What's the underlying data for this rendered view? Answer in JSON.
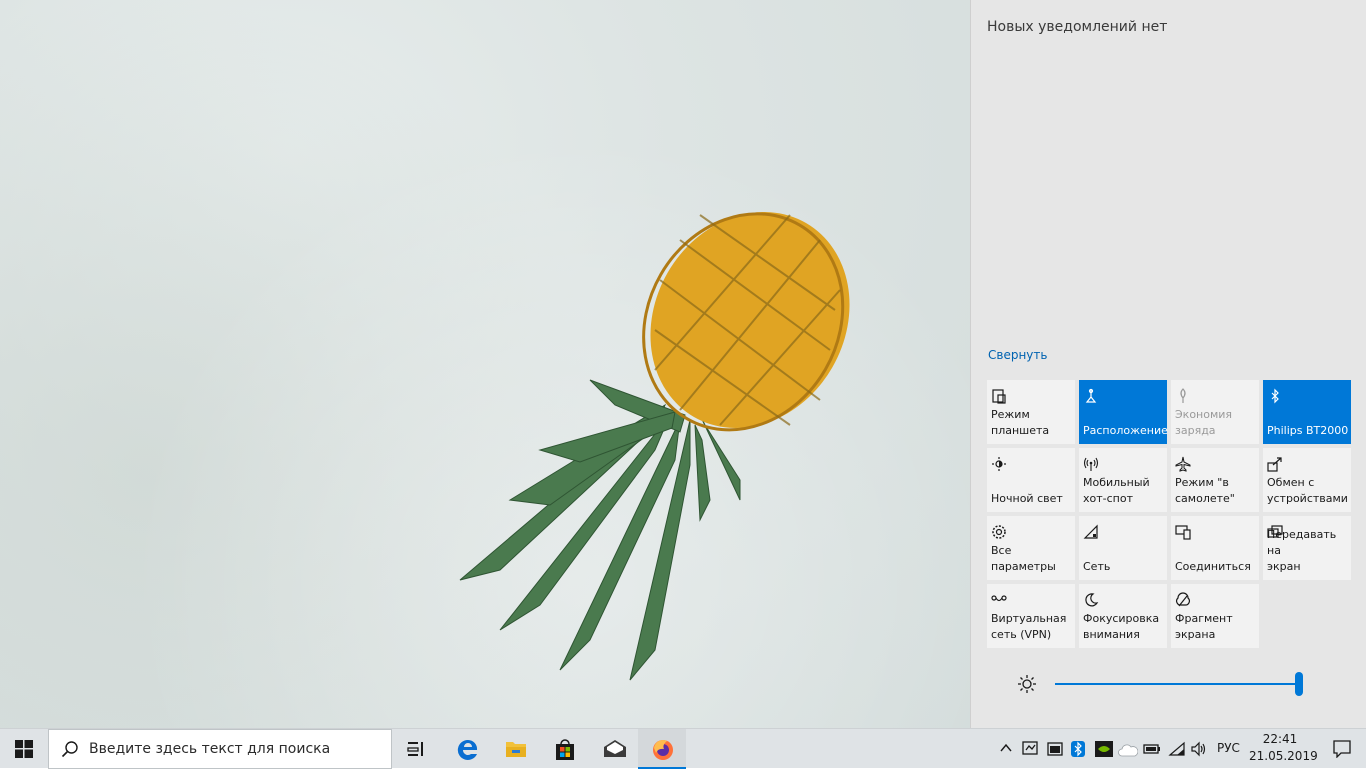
{
  "action_center": {
    "no_notifications": "Новых уведомлений нет",
    "collapse": "Свернуть",
    "tiles": [
      {
        "label": "Режим\nпланшета",
        "icon": "tablet-mode-icon",
        "state": "off"
      },
      {
        "label": "Расположение",
        "icon": "location-icon",
        "state": "on"
      },
      {
        "label": "Экономия\nзаряда",
        "icon": "battery-saver-icon",
        "state": "disabled"
      },
      {
        "label": "Philips BT2000",
        "icon": "bluetooth-icon",
        "state": "on"
      },
      {
        "label": "Ночной свет",
        "icon": "night-light-icon",
        "state": "off"
      },
      {
        "label": "Мобильный\nхот-спот",
        "icon": "mobile-hotspot-icon",
        "state": "off"
      },
      {
        "label": "Режим \"в\nсамолете\"",
        "icon": "airplane-icon",
        "state": "off"
      },
      {
        "label": "Обмен с\nустройствами",
        "icon": "nearby-sharing-icon",
        "state": "off"
      },
      {
        "label": "Все\nпараметры",
        "icon": "settings-gear-icon",
        "state": "off"
      },
      {
        "label": "Сеть",
        "icon": "network-icon",
        "state": "off"
      },
      {
        "label": "Соединиться",
        "icon": "connect-icon",
        "state": "off"
      },
      {
        "label": "Передавать на\nэкран",
        "icon": "project-icon",
        "state": "off"
      },
      {
        "label": "Виртуальная\nсеть (VPN)",
        "icon": "vpn-icon",
        "state": "off"
      },
      {
        "label": "Фокусировка\nвнимания",
        "icon": "focus-assist-icon",
        "state": "off"
      },
      {
        "label": "Фрагмент\nэкрана",
        "icon": "screen-snip-icon",
        "state": "off"
      }
    ],
    "brightness_percent": 100
  },
  "taskbar": {
    "search_placeholder": "Введите здесь текст для поиска",
    "apps": [
      "task-view-icon",
      "edge-icon",
      "file-explorer-icon",
      "store-icon",
      "mail-icon",
      "firefox-icon"
    ],
    "active_app": "firefox-icon",
    "language": "РУС",
    "time": "22:41",
    "date": "21.05.2019"
  },
  "colors": {
    "accent": "#0078d7",
    "link": "#0063b1",
    "tile_bg": "#f2f2f2",
    "panel_bg": "#e6e6e6",
    "taskbar_bg": "#dfe3e6"
  }
}
